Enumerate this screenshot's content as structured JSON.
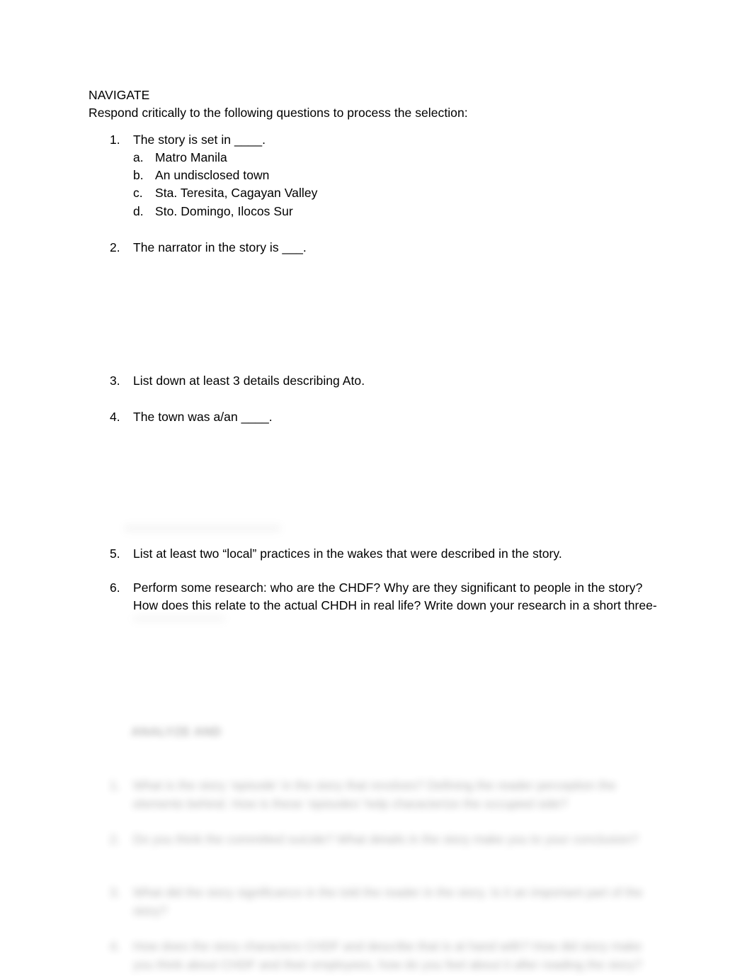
{
  "document": {
    "section_heading": "NAVIGATE",
    "instruction": "Respond critically to the following questions to process the selection:"
  },
  "questions": [
    {
      "number": "1.",
      "text": "The story is set in ____.",
      "options": [
        {
          "letter": "a.",
          "text": "Matro Manila"
        },
        {
          "letter": "b.",
          "text": "An undisclosed town"
        },
        {
          "letter": "c.",
          "text": "Sta. Teresita, Cagayan Valley"
        },
        {
          "letter": "d.",
          "text": "Sto. Domingo, Ilocos Sur"
        }
      ]
    },
    {
      "number": "2.",
      "text": "The narrator in the story is ___.",
      "options": []
    },
    {
      "number": "3.",
      "text": "List down at least 3 details describing Ato.",
      "options": []
    },
    {
      "number": "4.",
      "text": "The town was a/an ____.",
      "options": []
    },
    {
      "number": "5.",
      "text": "List at least two “local” practices in the wakes that were described in the story.",
      "options": []
    },
    {
      "number": "6.",
      "text": "Perform some research: who are the CHDF? Why are they significant to people in the story? How does this relate to the actual CHDH in real life? Write down your research in a short three-",
      "options": []
    }
  ],
  "obscured": {
    "note": "Content below is blurred/illegible in the source document.",
    "heading": "ANALYZE AND",
    "items": [
      {
        "number": "1.",
        "text": "What is the story ‘episode’ in the story that revolves? Defining the reader perception the elements behind. How is these ‘episodes’ help characterize the occupied side?"
      },
      {
        "number": "2.",
        "text": "Do you think the committed suicide? What details in the story make you to your conclusion?"
      },
      {
        "number": "3.",
        "text": "What did the story significance in the told the reader in the story. Is it an important part of the story?"
      },
      {
        "number": "4.",
        "text": "How does the story characters CHDF and describe that is at hand with? How did story make you think about CHDF and their employees, how do you feel about it after reading the story?"
      }
    ]
  }
}
